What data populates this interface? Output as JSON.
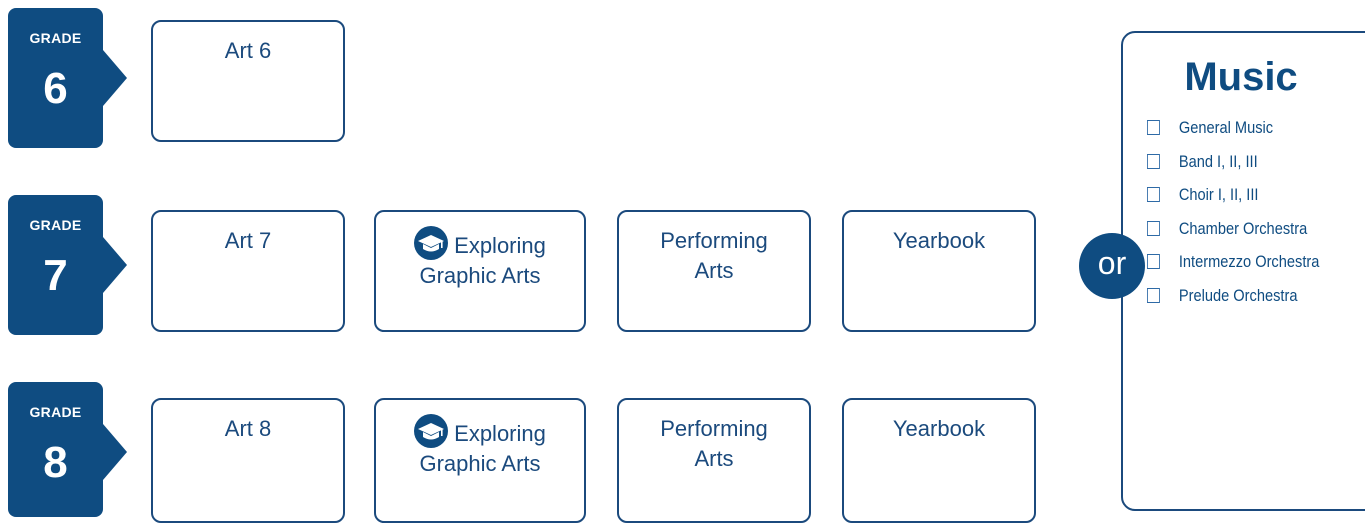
{
  "grades": [
    {
      "label": "GRADE",
      "number": "6",
      "courses": [
        "Art 6"
      ]
    },
    {
      "label": "GRADE",
      "number": "7",
      "courses": [
        "Art 7",
        "Exploring Graphic Arts",
        "Performing Arts",
        "Yearbook"
      ]
    },
    {
      "label": "GRADE",
      "number": "8",
      "courses": [
        "Art 8",
        "Exploring Graphic Arts",
        "Performing Arts",
        "Yearbook"
      ]
    }
  ],
  "course_lines": {
    "exploring_line1": "Exploring",
    "exploring_line2": "Graphic Arts",
    "performing_line1": "Performing",
    "performing_line2": "Arts"
  },
  "connector": "or",
  "music": {
    "title": "Music",
    "items": [
      "General Music",
      "Band I, II, III",
      "Choir I, II, III",
      "Chamber Orchestra",
      "Intermezzo Orchestra",
      "Prelude Orchestra"
    ]
  },
  "colors": {
    "navy": "#0f4c81",
    "border": "#1b4a7d"
  },
  "icons": {
    "exploring_badge": "graduation-cap-icon"
  }
}
